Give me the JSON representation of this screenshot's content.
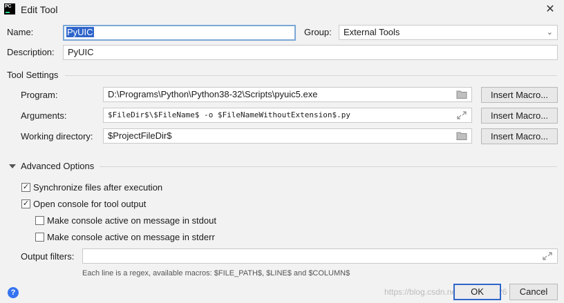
{
  "window": {
    "app_icon_text": "PC",
    "title": "Edit Tool",
    "close_glyph": "✕"
  },
  "form": {
    "name_label": "Name:",
    "name_value": "PyUIC",
    "group_label": "Group:",
    "group_value": "External Tools",
    "description_label": "Description:",
    "description_value": "PyUIC"
  },
  "tool_settings": {
    "heading": "Tool Settings",
    "program_label": "Program:",
    "program_value": "D:\\Programs\\Python\\Python38-32\\Scripts\\pyuic5.exe",
    "arguments_label": "Arguments:",
    "arguments_value": "$FileDir$\\$FileName$ -o $FileNameWithoutExtension$.py",
    "working_dir_label": "Working directory:",
    "working_dir_value": "$ProjectFileDir$",
    "insert_macro_label": "Insert Macro..."
  },
  "advanced": {
    "heading": "Advanced Options",
    "options": [
      {
        "label": "Synchronize files after execution",
        "checked": true
      },
      {
        "label": "Open console for tool output",
        "checked": true
      },
      {
        "label": "Make console active on message in stdout",
        "checked": false
      },
      {
        "label": "Make console active on message in stderr",
        "checked": false
      }
    ],
    "output_filters_label": "Output filters:",
    "output_filters_value": "",
    "hint": "Each line is a regex, available macros: $FILE_PATH$, $LINE$ and $COLUMN$"
  },
  "footer": {
    "help_glyph": "?",
    "ok_label": "OK",
    "cancel_label": "Cancel",
    "watermark": "https://blog.csdn.net/u014060926"
  },
  "icons": {
    "folder": "folder-icon",
    "expand": "expand-icon",
    "dropdown": "chevron-down-icon"
  },
  "colors": {
    "accent": "#2f65ca",
    "background": "#f2f2f2",
    "focus_border": "#7aa7d6"
  }
}
